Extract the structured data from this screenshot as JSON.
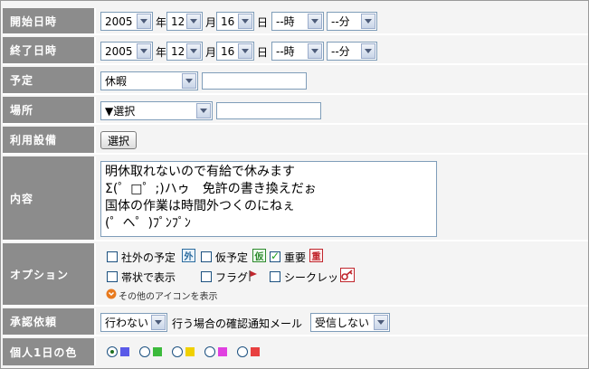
{
  "start": {
    "label": "開始日時",
    "year": "2005",
    "year_unit": "年",
    "month": "12",
    "month_unit": "月",
    "day": "16",
    "day_unit": "日",
    "hour": "--時",
    "minute": "--分"
  },
  "end": {
    "label": "終了日時",
    "year": "2005",
    "year_unit": "年",
    "month": "12",
    "month_unit": "月",
    "day": "16",
    "day_unit": "日",
    "hour": "--時",
    "minute": "--分"
  },
  "plan": {
    "label": "予定",
    "selected": "休暇",
    "text": ""
  },
  "place": {
    "label": "場所",
    "selected": "▼選択",
    "text": ""
  },
  "equipment": {
    "label": "利用設備",
    "button": "選択"
  },
  "content": {
    "label": "内容",
    "lines": [
      "明休取れないので有給で休みます",
      "Σ(゜□゜;)ハゥ　免許の書き換えだぉ",
      "国体の作業は時間外つくのにねぇ",
      "(゜ヘ゜)ﾌﾟﾝﾌﾟﾝ"
    ]
  },
  "options": {
    "label": "オプション",
    "items": [
      {
        "label": "社外の予定",
        "badge": "外",
        "checked": false
      },
      {
        "label": "仮予定",
        "badge": "仮",
        "checked": false
      },
      {
        "label": "重要",
        "badge": "重",
        "checked": true
      },
      {
        "label": "帯状で表示",
        "checked": false
      },
      {
        "label": "フラグ",
        "checked": false
      },
      {
        "label": "シークレット",
        "checked": false
      }
    ],
    "more_link": "その他のアイコンを表示",
    "badge_colors": {
      "outside": "#2b6b9e",
      "tentative": "#2d8a2d",
      "important": "#c0262d"
    }
  },
  "approval": {
    "label": "承認依頼",
    "selected": "行わない",
    "text": "行う場合の確認通知メール",
    "mail_selected": "受信しない"
  },
  "color": {
    "label": "個人1日の色",
    "options": [
      "#5a5ae8",
      "#3cba3c",
      "#f0d000",
      "#e040e0",
      "#e84040"
    ],
    "selected_index": 0
  }
}
